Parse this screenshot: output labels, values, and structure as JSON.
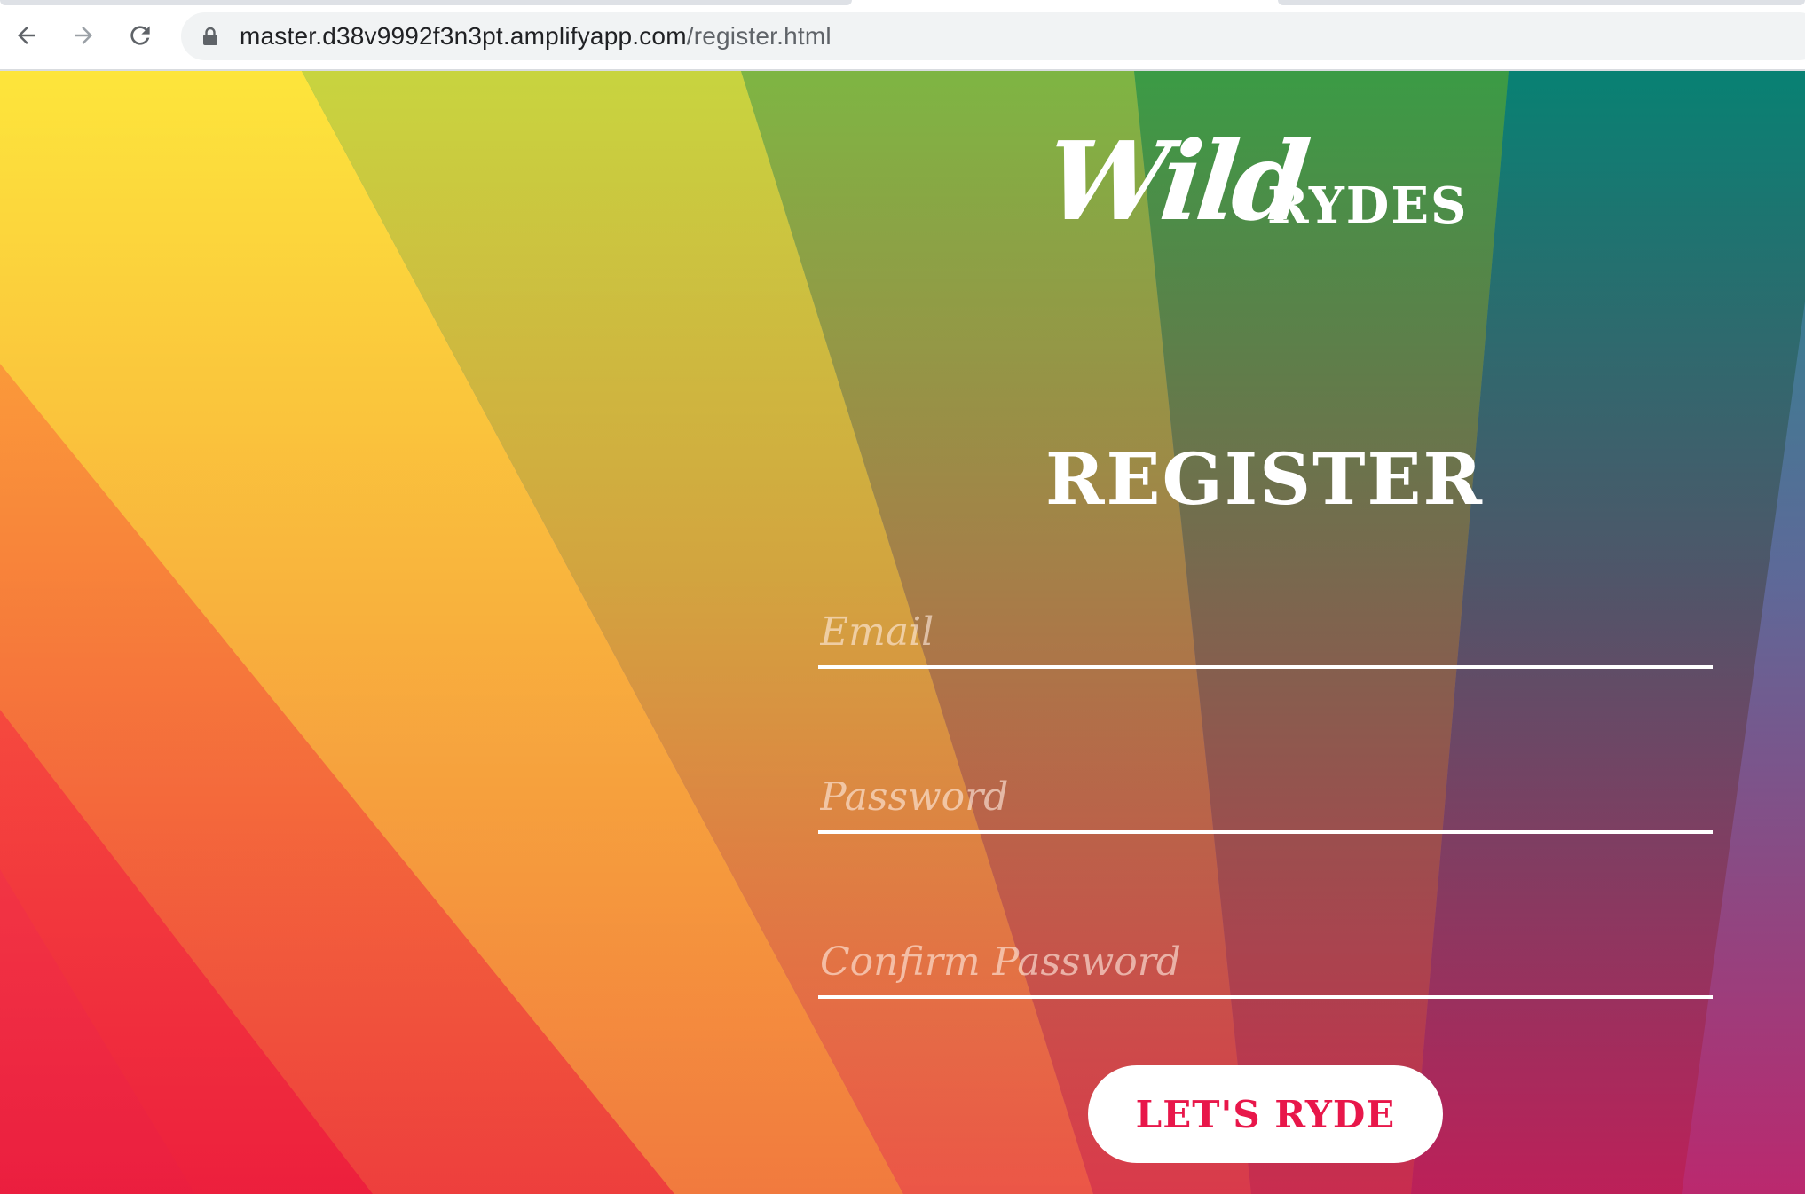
{
  "browser": {
    "url_host": "master.d38v9992f3n3pt.amplifyapp.com",
    "url_path": "/register.html",
    "icons": {
      "back": "back-arrow-icon",
      "forward": "forward-arrow-icon",
      "reload": "reload-icon",
      "secure": "lock-icon"
    }
  },
  "brand": {
    "logo_script": "Wild",
    "logo_caps": "RYDES"
  },
  "form": {
    "title": "REGISTER",
    "email_placeholder": "Email",
    "password_placeholder": "Password",
    "confirm_placeholder": "Confirm Password",
    "email_value": "",
    "password_value": "",
    "confirm_value": "",
    "submit_label": "LET'S RYDE"
  },
  "colors": {
    "button_text": "#e8174a",
    "field_underline": "#ffffff",
    "rays": [
      "#fde73c",
      "#c7d33f",
      "#7db443",
      "#3a9a45",
      "#0a8172",
      "#3489bd"
    ]
  }
}
